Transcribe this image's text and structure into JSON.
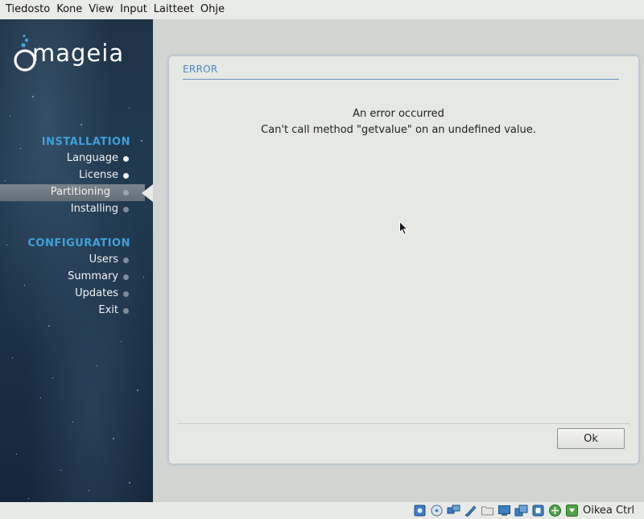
{
  "menubar": {
    "items": [
      "Tiedosto",
      "Kone",
      "View",
      "Input",
      "Laitteet",
      "Ohje"
    ]
  },
  "sidebar": {
    "logo_text": "mageia",
    "sections": [
      {
        "title": "INSTALLATION",
        "items": [
          {
            "label": "Language",
            "state": "done"
          },
          {
            "label": "License",
            "state": "done"
          },
          {
            "label": "Partitioning",
            "state": "current"
          },
          {
            "label": "Installing",
            "state": "pending"
          }
        ]
      },
      {
        "title": "CONFIGURATION",
        "items": [
          {
            "label": "Users",
            "state": "pending"
          },
          {
            "label": "Summary",
            "state": "pending"
          },
          {
            "label": "Updates",
            "state": "pending"
          },
          {
            "label": "Exit",
            "state": "pending"
          }
        ]
      }
    ]
  },
  "dialog": {
    "title": "ERROR",
    "heading": "An error occurred",
    "message": "Can't call method \"getvalue\" on an undefined value.",
    "ok_label": "Ok"
  },
  "statusbar": {
    "icons": [
      "hard-disk-icon",
      "optical-drive-icon",
      "audio-icon",
      "network-icon",
      "usb-icon",
      "shared-folder-icon",
      "display-icon",
      "video-capture-icon",
      "cpu-icon",
      "mouse-integration-icon",
      "keyboard-icon"
    ],
    "host_key": "Oikea Ctrl"
  },
  "colors": {
    "accent": "#3da0dc",
    "dialog_title": "#4f86c6",
    "sidebar_bg": "#1f3346"
  }
}
